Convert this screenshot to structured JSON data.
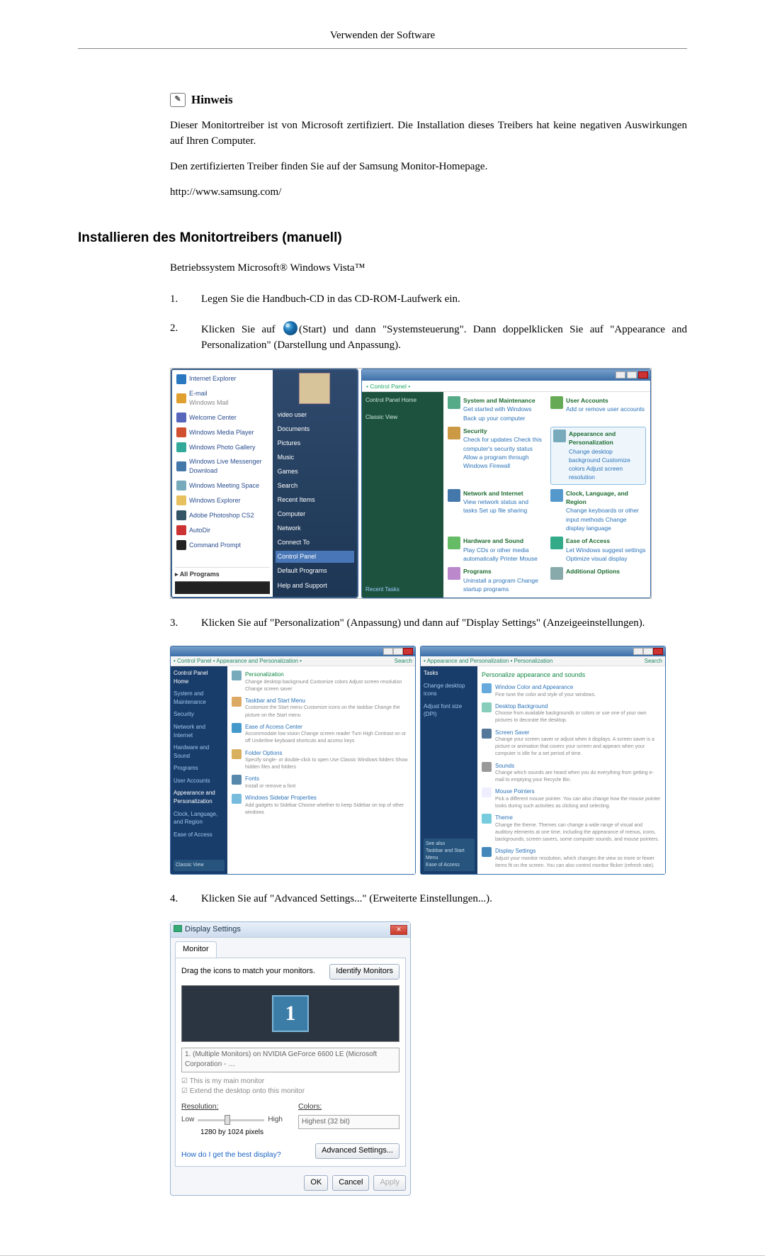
{
  "header": {
    "title": "Verwenden der Software"
  },
  "note": {
    "label": "Hinweis",
    "p1": "Dieser Monitortreiber ist von Microsoft zertifiziert. Die Installation dieses Treibers hat keine negativen Auswirkungen auf Ihren Computer.",
    "p2": "Den zertifizierten Treiber finden Sie auf der Samsung Monitor-Homepage.",
    "url": "http://www.samsung.com/"
  },
  "section": {
    "heading": "Installieren des Monitortreibers (manuell)"
  },
  "os_line": "Betriebssystem Microsoft® Windows Vista™",
  "steps": {
    "s1_num": "1.",
    "s1": "Legen Sie die Handbuch-CD in das CD-ROM-Laufwerk ein.",
    "s2_num": "2.",
    "s2a": "Klicken Sie auf",
    "s2b": "(Start) und dann \"Systemsteuerung\". Dann doppelklicken Sie auf \"Appearance and Personalization\" (Darstellung und Anpassung).",
    "s3_num": "3.",
    "s3": "Klicken Sie auf \"Personalization\" (Anpassung) und dann auf \"Display Settings\" (Anzeigeeinstellungen).",
    "s4_num": "4.",
    "s4": "Klicken Sie auf \"Advanced Settings...\" (Erweiterte Einstellungen...)."
  },
  "startmenu": {
    "left": {
      "p1": "Internet Explorer",
      "p2": "E-mail",
      "p2b": "Windows Mail",
      "p3": "Welcome Center",
      "p4": "Windows Media Player",
      "p5": "Windows Photo Gallery",
      "p6": "Windows Live Messenger Download",
      "p7": "Windows Meeting Space",
      "p8": "Windows Explorer",
      "p9": "Adobe Photoshop CS2",
      "p10": "AutoDir",
      "p11": "Command Prompt",
      "all": "All Programs"
    },
    "right": {
      "r1": "video user",
      "r2": "Documents",
      "r3": "Pictures",
      "r4": "Music",
      "r5": "Games",
      "r6": "Search",
      "r7": "Recent Items",
      "r8": "Computer",
      "r9": "Network",
      "r10": "Connect To",
      "r11": "Control Panel",
      "r12": "Default Programs",
      "r13": "Help and Support"
    }
  },
  "cpanel": {
    "crumb": "• Control Panel •",
    "side": {
      "s1": "Control Panel Home",
      "s2": "Classic View",
      "s3": "Recent Tasks"
    },
    "items": {
      "i1_t": "System and Maintenance",
      "i1_s": "Get started with Windows\nBack up your computer",
      "i2_t": "User Accounts",
      "i2_s": "Add or remove user accounts",
      "i3_t": "Security",
      "i3_s": "Check for updates\nCheck this computer's security status\nAllow a program through Windows Firewall",
      "i4_t": "Appearance and Personalization",
      "i4_s": "Change desktop background\nCustomize colors\nAdjust screen resolution",
      "i5_t": "Network and Internet",
      "i5_s": "View network status and tasks\nSet up file sharing",
      "i6_t": "Clock, Language, and Region",
      "i6_s": "Change keyboards or other input methods\nChange display language",
      "i7_t": "Hardware and Sound",
      "i7_s": "Play CDs or other media automatically\nPrinter\nMouse",
      "i8_t": "Ease of Access",
      "i8_s": "Let Windows suggest settings\nOptimize visual display",
      "i9_t": "Programs",
      "i9_s": "Uninstall a program\nChange startup programs",
      "i10_t": "Additional Options"
    }
  },
  "pane_left": {
    "crumb": "• Control Panel • Appearance and Personalization •",
    "side": {
      "a1": "Control Panel Home",
      "a2": "System and Maintenance",
      "a3": "Security",
      "a4": "Network and Internet",
      "a5": "Hardware and Sound",
      "a6": "Programs",
      "a7": "User Accounts",
      "a8": "Appearance and Personalization",
      "a9": "Clock, Language, and Region",
      "a10": "Ease of Access",
      "a11": "Classic View"
    },
    "items": {
      "h1": "Personalization",
      "h1s": "Change desktop background   Customize colors   Adjust screen resolution   Change screen saver",
      "h2": "Taskbar and Start Menu",
      "h2s": "Customize the Start menu   Customize icons on the taskbar   Change the picture on the Start menu",
      "h3": "Ease of Access Center",
      "h3s": "Accommodate low vision   Change screen reader   Turn High Contrast on or off   Underline keyboard shortcuts and access keys",
      "h4": "Folder Options",
      "h4s": "Specify single- or double-click to open   Use Classic Windows folders   Show hidden files and folders",
      "h5": "Fonts",
      "h5s": "Install or remove a font",
      "h6": "Windows Sidebar Properties",
      "h6s": "Add gadgets to Sidebar   Choose whether to keep Sidebar on top of other windows"
    }
  },
  "pane_right": {
    "crumb": "• Appearance and Personalization • Personalization",
    "side": {
      "a1": "Tasks",
      "a2": "Change desktop icons",
      "a3": "Adjust font size (DPI)"
    },
    "hd": "Personalize appearance and sounds",
    "items": {
      "h1": "Window Color and Appearance",
      "h1s": "Fine tune the color and style of your windows.",
      "h2": "Desktop Background",
      "h2s": "Choose from available backgrounds or colors or use one of your own pictures to decorate the desktop.",
      "h3": "Screen Saver",
      "h3s": "Change your screen saver or adjust when it displays. A screen saver is a picture or animation that covers your screen and appears when your computer is idle for a set period of time.",
      "h4": "Sounds",
      "h4s": "Change which sounds are heard when you do everything from getting e-mail to emptying your Recycle Bin.",
      "h5": "Mouse Pointers",
      "h5s": "Pick a different mouse pointer. You can also change how the mouse pointer looks during such activities as clicking and selecting.",
      "h6": "Theme",
      "h6s": "Change the theme. Themes can change a wide range of visual and auditory elements at one time, including the appearance of menus, icons, backgrounds, screen savers, some computer sounds, and mouse pointers.",
      "h7": "Display Settings",
      "h7s": "Adjust your monitor resolution, which changes the view so more or fewer items fit on the screen. You can also control monitor flicker (refresh rate)."
    }
  },
  "dialog": {
    "title": "Display Settings",
    "tab": "Monitor",
    "dragline": "Drag the icons to match your monitors.",
    "identify": "Identify Monitors",
    "monnum": "1",
    "combo": "1. (Multiple Monitors) on NVIDIA GeForce 6600 LE (Microsoft Corporation - …",
    "chk1": "This is my main monitor",
    "chk2": "Extend the desktop onto this monitor",
    "res_label": "Resolution:",
    "res_low": "Low",
    "res_high": "High",
    "res_value": "1280 by 1024 pixels",
    "col_label": "Colors:",
    "col_value": "Highest (32 bit)",
    "link": "How do I get the best display?",
    "advanced": "Advanced Settings...",
    "ok": "OK",
    "cancel": "Cancel",
    "apply": "Apply"
  }
}
